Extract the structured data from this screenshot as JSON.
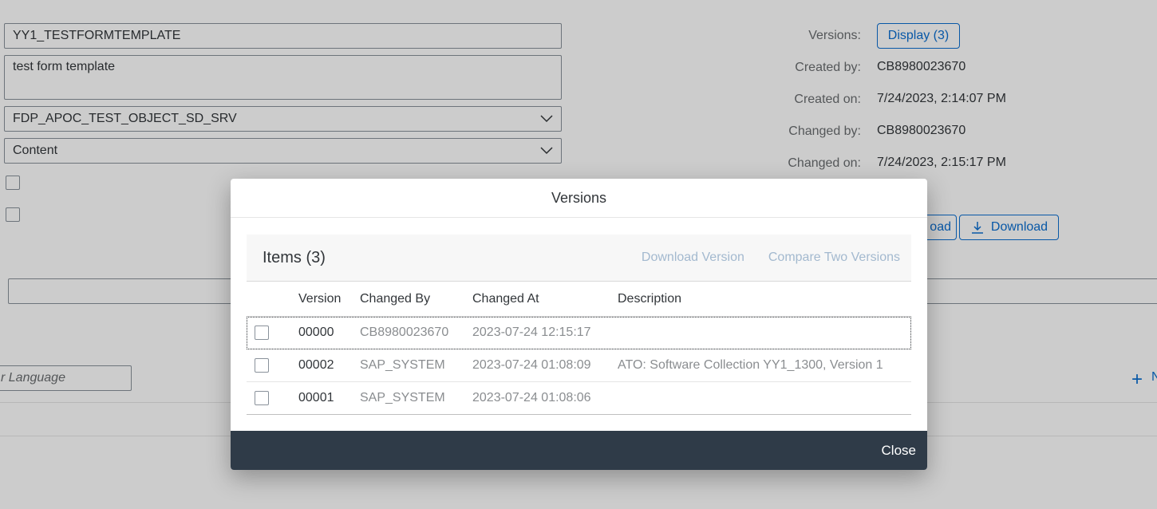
{
  "form": {
    "template_id": "YY1_TESTFORMTEMPLATE",
    "description": "test form template",
    "data_source": "FDP_APOC_TEST_OBJECT_SD_SRV",
    "content_type": "Content",
    "language_placeholder": "r Language"
  },
  "admin": {
    "versions_label": "Versions:",
    "display_button": "Display (3)",
    "created_by_label": "Created by:",
    "created_by": "CB8980023670",
    "created_on_label": "Created on:",
    "created_on": "7/24/2023, 2:14:07 PM",
    "changed_by_label": "Changed by:",
    "changed_by": "CB8980023670",
    "changed_on_label": "Changed on:",
    "changed_on": "7/24/2023, 2:15:17 PM",
    "upload_button_partial": "oad",
    "download_button": "Download",
    "add_partial": "N"
  },
  "dialog": {
    "title": "Versions",
    "items_title": "Items (3)",
    "download_version": "Download Version",
    "compare_versions": "Compare Two Versions",
    "columns": [
      "Version",
      "Changed By",
      "Changed At",
      "Description"
    ],
    "rows": [
      {
        "version": "00000",
        "changed_by": "CB8980023670",
        "changed_at": "2023-07-24 12:15:17",
        "description": ""
      },
      {
        "version": "00002",
        "changed_by": "SAP_SYSTEM",
        "changed_at": "2023-07-24 01:08:09",
        "description": "ATO: Software Collection YY1_1300, Version 1"
      },
      {
        "version": "00001",
        "changed_by": "SAP_SYSTEM",
        "changed_at": "2023-07-24 01:08:06",
        "description": ""
      }
    ],
    "close": "Close"
  },
  "colors": {
    "accent": "#0a6ed1",
    "footer": "#2f3b48",
    "disabled_link": "#a3b9cf"
  }
}
